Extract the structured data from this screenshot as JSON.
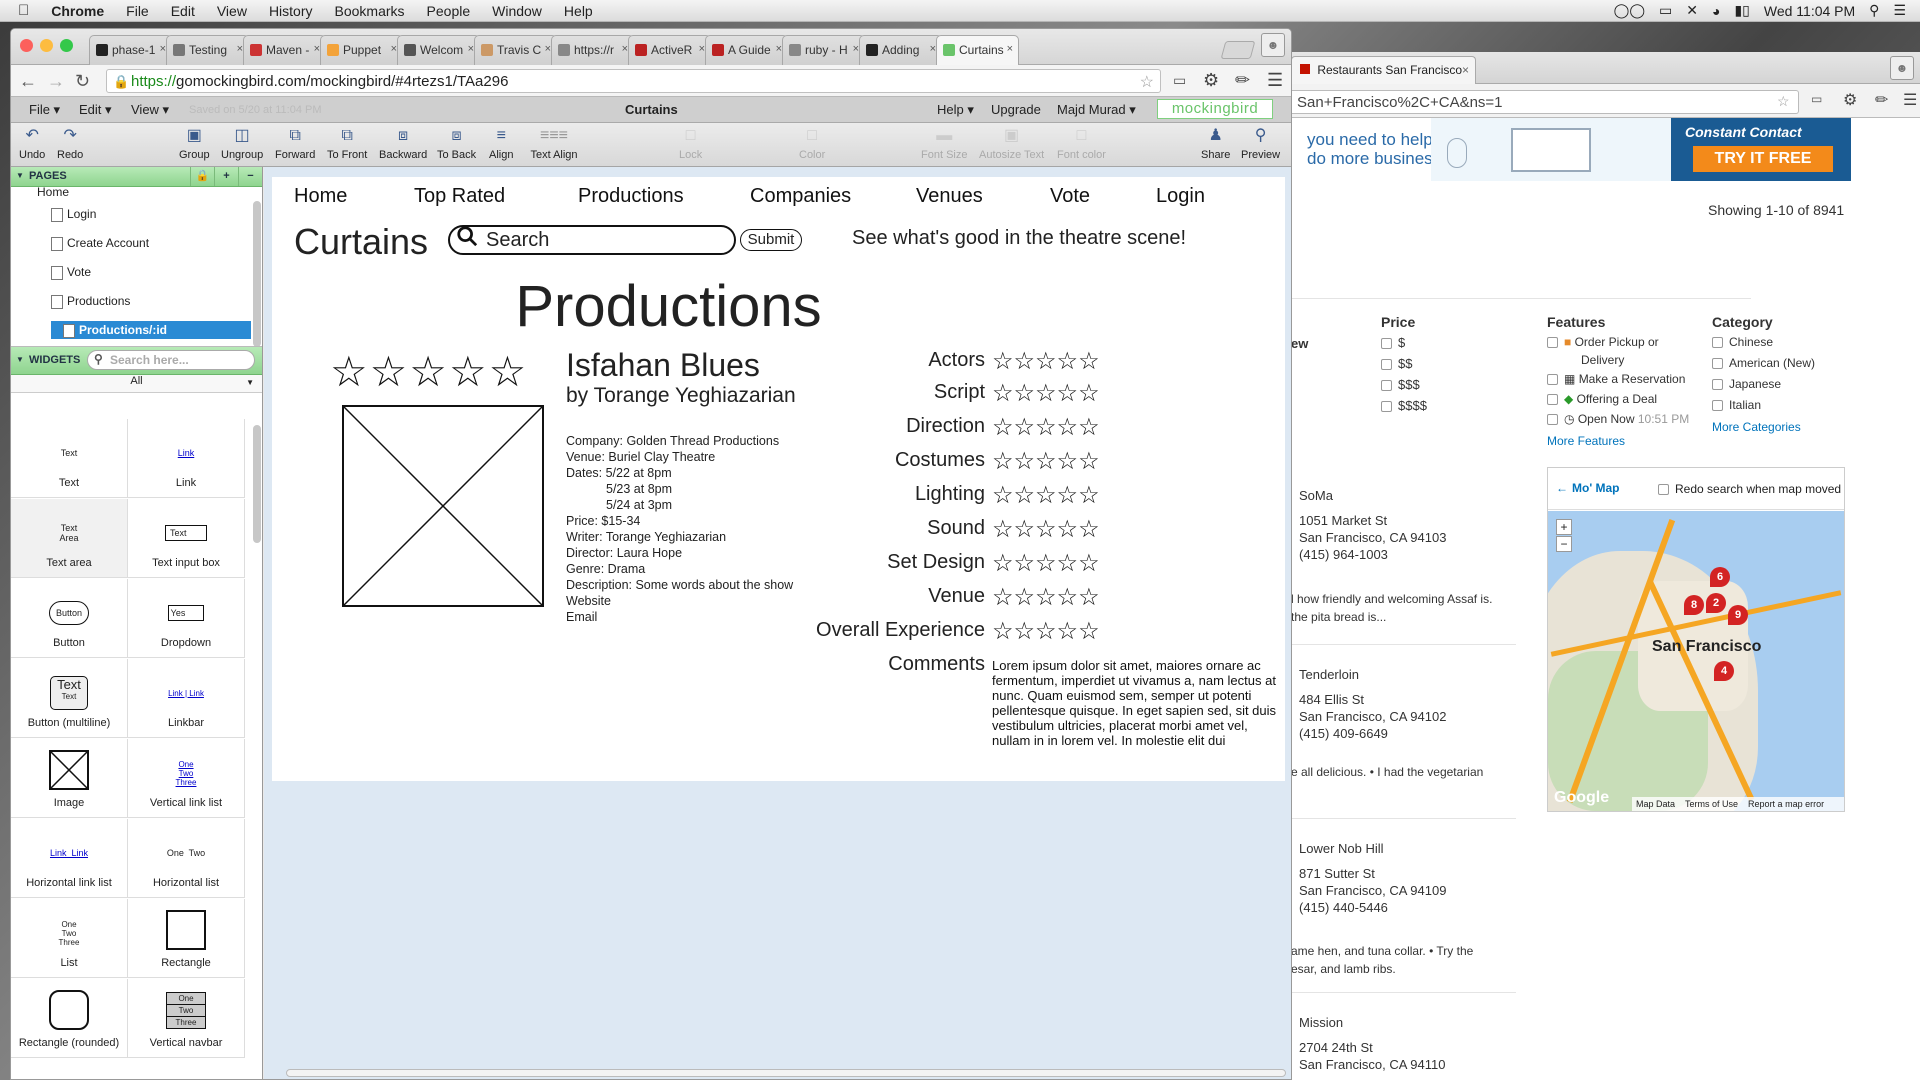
{
  "menubar": {
    "apple": "",
    "items": [
      "Chrome",
      "File",
      "Edit",
      "View",
      "History",
      "Bookmarks",
      "People",
      "Window",
      "Help"
    ],
    "clock": "Wed 11:04 PM"
  },
  "browser": {
    "tabs": [
      {
        "label": "phase-1",
        "color": "#222"
      },
      {
        "label": "Testing",
        "color": "#777"
      },
      {
        "label": "Maven -",
        "color": "#c33"
      },
      {
        "label": "Puppet",
        "color": "#f3a33a"
      },
      {
        "label": "Welcom",
        "color": "#555"
      },
      {
        "label": "Travis C",
        "color": "#c96"
      },
      {
        "label": "https://r",
        "color": "#888"
      },
      {
        "label": "ActiveR",
        "color": "#b22"
      },
      {
        "label": "A Guide",
        "color": "#b22"
      },
      {
        "label": "ruby - H",
        "color": "#888"
      },
      {
        "label": "Adding",
        "color": "#222"
      },
      {
        "label": "Curtains",
        "color": "#6ac46a"
      }
    ],
    "url_scheme": "https://",
    "url_rest": "gomockingbird.com/mockingbird/#4rtezs1/TAa296"
  },
  "app": {
    "menus": [
      "File ▾",
      "Edit ▾",
      "View ▾"
    ],
    "saved": "Saved on 5/20 at 11:04 PM",
    "doc_title": "Curtains",
    "right_menus": [
      "Help ▾",
      "Upgrade",
      "Majd Murad ▾"
    ],
    "brand": "mockingbird",
    "toolbar": [
      "Undo",
      "Redo",
      "Group",
      "Ungroup",
      "Forward",
      "To Front",
      "Backward",
      "To Back",
      "Align",
      "Text Align",
      "Lock",
      "Color",
      "Font Size",
      "Autosize Text",
      "Font color",
      "Share",
      "Preview"
    ]
  },
  "pages_panel": {
    "title": "PAGES",
    "items": [
      "Home",
      "Login",
      "Create Account",
      "Vote",
      "Productions",
      "Productions/:id"
    ]
  },
  "widgets_panel": {
    "title": "WIDGETS",
    "search_placeholder": "Search here...",
    "filter": "All",
    "items": [
      "Text",
      "Link",
      "Text area",
      "Text input box",
      "Button",
      "Dropdown",
      "Button (multiline)",
      "Linkbar",
      "Image",
      "Vertical link list",
      "Horizontal link list",
      "Horizontal list",
      "List",
      "Rectangle",
      "Rectangle (rounded)",
      "Vertical navbar"
    ],
    "preview": {
      "text": "Text",
      "link": "Link",
      "textarea": "Text\nArea",
      "textinput": "Text",
      "button": "Button",
      "dropdown": "Yes",
      "multiline_big": "Text",
      "multiline_small": "Text",
      "linkbar": "Link | Link",
      "vlinks": [
        "One",
        "Two",
        "Three"
      ],
      "hlinks": "Link  Link",
      "hlist": "One  Two",
      "list": [
        "One",
        "Two",
        "Three"
      ],
      "vnav": [
        "One",
        "Two",
        "Three"
      ]
    }
  },
  "mock": {
    "nav": [
      "Home",
      "Top Rated",
      "Productions",
      "Companies",
      "Venues",
      "Vote",
      "Login"
    ],
    "logo": "Curtains",
    "search": "Search",
    "submit": "Submit",
    "tagline": "See what's good in the theatre scene!",
    "heading": "Productions",
    "big_stars": "☆☆☆☆☆",
    "show_title": "Isfahan Blues",
    "show_by": "by Torange Yeghiazarian",
    "details": [
      "Company: Golden Thread Productions",
      "Venue: Buriel Clay Theatre",
      "Dates: 5/22 at 8pm",
      "5/23 at 8pm",
      "5/24 at 3pm",
      "Price: $15-34",
      "Writer: Torange Yeghiazarian",
      "Director: Laura Hope",
      "Genre: Drama",
      "Description: Some words about the show",
      "Website",
      "Email"
    ],
    "ratings": [
      "Actors",
      "Script",
      "Direction",
      "Costumes",
      "Lighting",
      "Sound",
      "Set Design",
      "Venue",
      "Overall Experience"
    ],
    "rating_stars": "☆☆☆☆☆",
    "comments_label": "Comments",
    "comments": "Lorem ipsum dolor sit amet, maiores ornare ac fermentum, imperdiet ut vivamus a, nam lectus at nunc. Quam euismod sem, semper ut potenti pellentesque quisque. In eget sapien sed, sit duis vestibulum ultricies, placerat morbi amet vel, nullam in in lorem vel. In molestie elit dui"
  },
  "yelp": {
    "tab": "Restaurants San Francisco",
    "url": "San+Francisco%2C+CA&ns=1",
    "ad_text1": "you need to help",
    "ad_text2": "do more business.",
    "ad_brand": "Constant Contact",
    "ad_cta": "TRY IT FREE",
    "showing": "Showing 1-10 of 8941",
    "frag_ew": "ew",
    "price_title": "Price",
    "prices": [
      "$",
      "$$",
      "$$$",
      "$$$$"
    ],
    "features_title": "Features",
    "features": [
      "Order Pickup or",
      "Delivery",
      "Make a Reservation",
      "Offering a Deal",
      "Open Now"
    ],
    "open_now_time": "10:51 PM",
    "more_features": "More Features",
    "category_title": "Category",
    "categories": [
      "Chinese",
      "American (New)",
      "Japanese",
      "Italian"
    ],
    "more_categories": "More Categories",
    "map_title": "Mo' Map",
    "redo": "Redo search when map moved",
    "map_city": "San Francisco",
    "map_footer": [
      "Map Data",
      "Terms of Use",
      "Report a map error"
    ],
    "google": "Google",
    "markers": [
      "6",
      "2",
      "8",
      "9",
      "4"
    ],
    "listings": [
      {
        "hood": "SoMa",
        "addr": "1051 Market St",
        "city": "San Francisco, CA 94103",
        "phone": "(415) 964-1003",
        "snippet1": "l how friendly and welcoming Assaf is.",
        "snippet2": "the pita bread is..."
      },
      {
        "hood": "Tenderloin",
        "addr": "484 Ellis St",
        "city": "San Francisco, CA 94102",
        "phone": "(415) 409-6649",
        "snippet1": "e all delicious.  •  I had the vegetarian",
        "snippet2": ""
      },
      {
        "hood": "Lower Nob Hill",
        "addr": "871 Sutter St",
        "city": "San Francisco, CA 94109",
        "phone": "(415) 440-5446",
        "snippet1": "ame hen, and tuna collar.  •  Try the",
        "snippet2": "esar, and lamb ribs."
      },
      {
        "hood": "Mission",
        "addr": "2704 24th St",
        "city": "San Francisco, CA 94110",
        "phone": "",
        "snippet1": "",
        "snippet2": ""
      }
    ]
  }
}
